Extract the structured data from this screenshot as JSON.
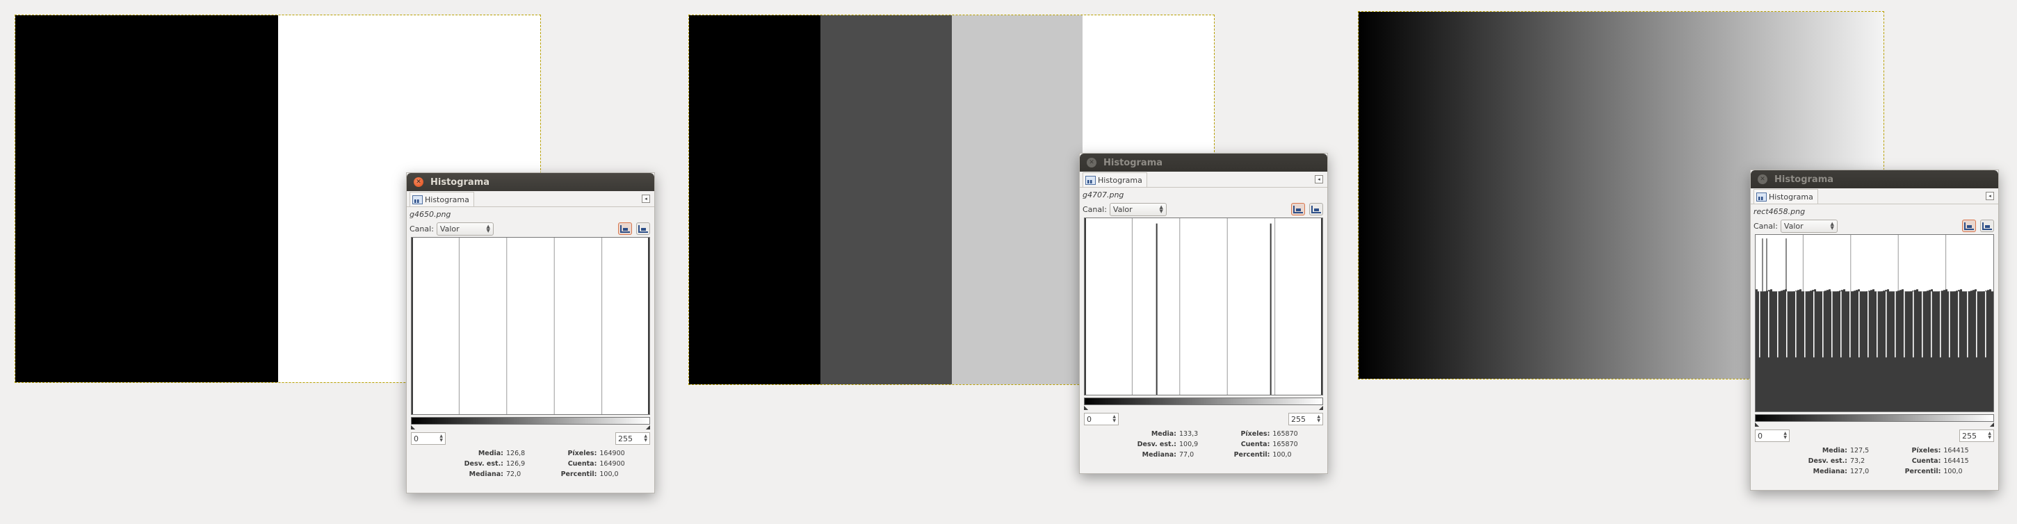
{
  "images": [
    {
      "bands": [
        "#000000",
        "#ffffff"
      ]
    },
    {
      "bands": [
        "#000000",
        "#4c4c4c",
        "#c8c8c8",
        "#ffffff"
      ]
    },
    {
      "gradient": [
        "#000000",
        "#f4f4f4"
      ]
    }
  ],
  "windows": [
    {
      "title": "Histograma",
      "tab": "Histograma",
      "filename": "g4650.png",
      "canal_label": "Canal:",
      "canal_value": "Valor",
      "range_low": "0",
      "range_high": "255",
      "stats": {
        "media_label": "Media:",
        "media": "126,8",
        "desv_label": "Desv. est.:",
        "desv": "126,9",
        "mediana_label": "Mediana:",
        "mediana": "72,0",
        "pixeles_label": "Píxeles:",
        "pixeles": "164900",
        "cuenta_label": "Cuenta:",
        "cuenta": "164900",
        "percentil_label": "Percentil:",
        "percentil": "100,0"
      },
      "histogram": {
        "spikes": [
          {
            "value": 0,
            "level": 1.0
          },
          {
            "value": 255,
            "level": 1.0
          }
        ]
      }
    },
    {
      "title": "Histograma",
      "tab": "Histograma",
      "filename": "g4707.png",
      "canal_label": "Canal:",
      "canal_value": "Valor",
      "range_low": "0",
      "range_high": "255",
      "stats": {
        "media_label": "Media:",
        "media": "133,3",
        "desv_label": "Desv. est.:",
        "desv": "100,9",
        "mediana_label": "Mediana:",
        "mediana": "77,0",
        "pixeles_label": "Píxeles:",
        "pixeles": "165870",
        "cuenta_label": "Cuenta:",
        "cuenta": "165870",
        "percentil_label": "Percentil:",
        "percentil": "100,0"
      },
      "histogram": {
        "spikes": [
          {
            "value": 0,
            "level": 1.0
          },
          {
            "value": 77,
            "level": 0.97
          },
          {
            "value": 200,
            "level": 0.97
          },
          {
            "value": 255,
            "level": 1.0
          }
        ]
      }
    },
    {
      "title": "Histograma",
      "tab": "Histograma",
      "filename": "rect4658.png",
      "canal_label": "Canal:",
      "canal_value": "Valor",
      "range_low": "0",
      "range_high": "255",
      "stats": {
        "media_label": "Media:",
        "media": "127,5",
        "desv_label": "Desv. est.:",
        "desv": "73,2",
        "mediana_label": "Mediana:",
        "mediana": "127,0",
        "pixeles_label": "Píxeles:",
        "pixeles": "164415",
        "cuenta_label": "Cuenta:",
        "cuenta": "164415",
        "percentil_label": "Percentil:",
        "percentil": "100,0"
      },
      "histogram": {
        "plateau_level": 0.68,
        "peak_level": 0.3,
        "color": "#3c3c3c"
      }
    }
  ],
  "colors": {
    "selection_border": "#b8a000",
    "active_close": "#df4b16",
    "histogram_fill": "#3c3c3c"
  }
}
